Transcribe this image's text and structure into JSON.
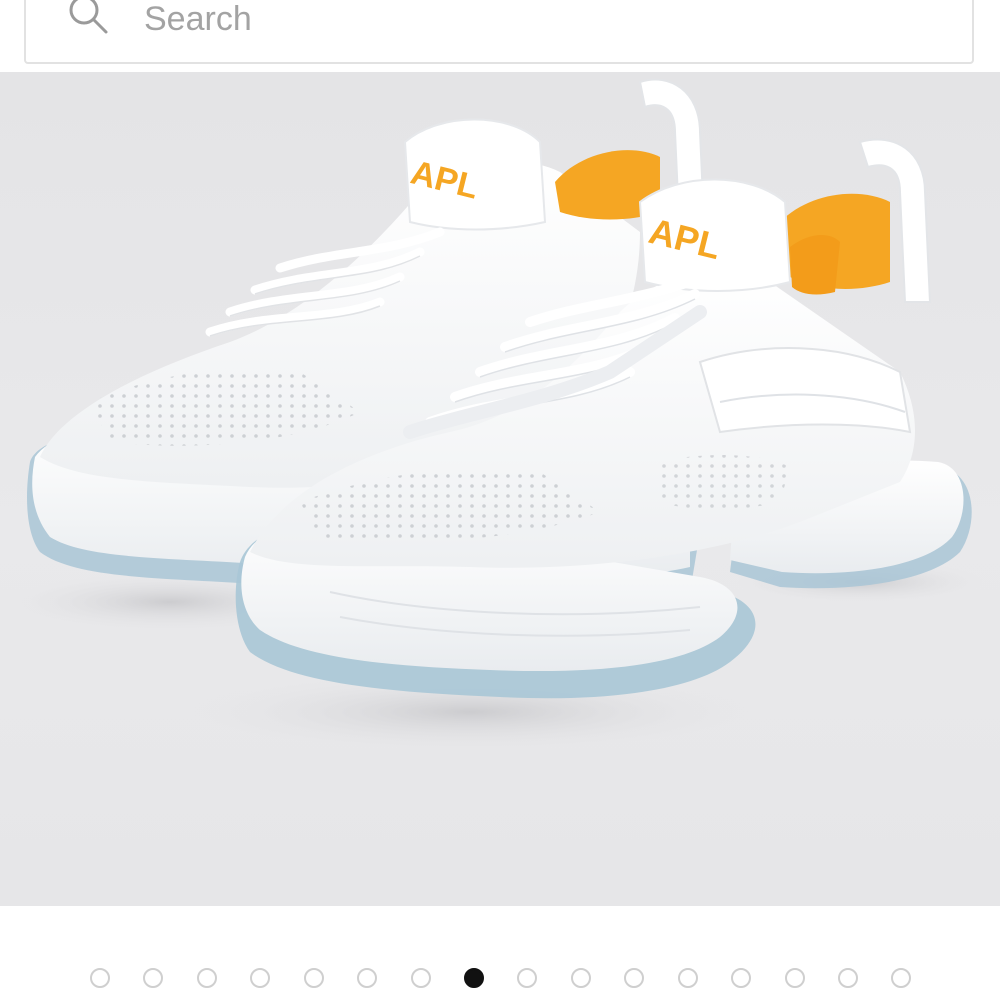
{
  "search": {
    "placeholder": "Search"
  },
  "product_image": {
    "brand_logo_text": "APL",
    "accent_color": "#f5a623",
    "sole_tint": "#a9c6d6"
  },
  "pagination": {
    "total": 16,
    "active_index": 7
  },
  "icons": {
    "search": "search-icon"
  }
}
